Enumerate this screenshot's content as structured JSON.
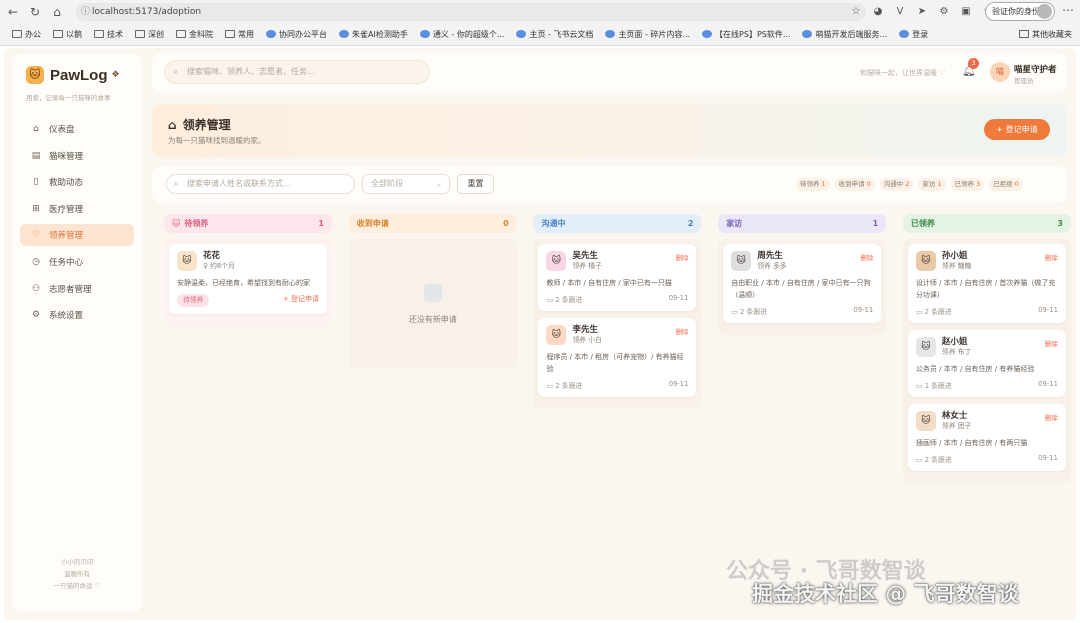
{
  "browser": {
    "url": "localhost:5173/adoption",
    "verify_label": "验证你的身份",
    "bookmarks": [
      "办公",
      "以鹅",
      "技术",
      "深创",
      "金科院",
      "常用",
      "协同办公平台",
      "朱雀AI检测助手",
      "通义 - 你的超级个...",
      "主页 - 飞书云文档",
      "主页面 - 碎片内容...",
      "【在线PS】PS软件...",
      "萌猫开发后端服务...",
      "登录"
    ],
    "other_bookmarks": "其他收藏夹"
  },
  "sidebar": {
    "app_name": "PawLog",
    "slogan": "用爱，记录每一只猫咪的故事",
    "menu": [
      {
        "label": "仪表盘",
        "icon": "home-icon",
        "glyph": "⌂"
      },
      {
        "label": "猫咪管理",
        "icon": "cat-file-icon",
        "glyph": "▤"
      },
      {
        "label": "救助动态",
        "icon": "book-icon",
        "glyph": "▯"
      },
      {
        "label": "医疗管理",
        "icon": "medical-icon",
        "glyph": "⊞"
      },
      {
        "label": "领养管理",
        "icon": "heart-icon",
        "glyph": "♡"
      },
      {
        "label": "任务中心",
        "icon": "clock-icon",
        "glyph": "◷"
      },
      {
        "label": "志愿者管理",
        "icon": "user-icon",
        "glyph": "⚇"
      },
      {
        "label": "系统设置",
        "icon": "gear-icon",
        "glyph": "⚙"
      }
    ],
    "footer": [
      "小小的爪印",
      "温暖所有",
      "一只猫的命运 ♡"
    ]
  },
  "topbar": {
    "search_placeholder": "搜索猫咪、领养人、志愿者、任务...",
    "motto": "和猫咪一起，让世界温暖 ♡",
    "notification_count": "3",
    "avatar_text": "喵",
    "user_name": "喵星守护者",
    "user_role": "管理员"
  },
  "header": {
    "title": "领养管理",
    "subtitle": "为每一只猫咪找到温暖的家。",
    "register_button": "+ 登记申请"
  },
  "filters": {
    "search_placeholder": "搜索申请人姓名或联系方式...",
    "stage_select": "全部阶段",
    "reset_button": "重置",
    "stats": [
      {
        "label": "待领养",
        "count": "1"
      },
      {
        "label": "收到申请",
        "count": "0"
      },
      {
        "label": "沟通中",
        "count": "2"
      },
      {
        "label": "家访",
        "count": "1"
      },
      {
        "label": "已领养",
        "count": "3"
      },
      {
        "label": "已拒绝",
        "count": "0"
      }
    ]
  },
  "board": {
    "columns": [
      {
        "title": "待领养",
        "icon": "🐱",
        "count": "1",
        "head_bg": "#fde7ec",
        "head_color": "#d9607a",
        "body_bg": "#fdf2f0",
        "cards": [
          {
            "name": "花花",
            "sub": "♀ 约8个月",
            "avatar": "🐱",
            "desc": "安静温柔，已经绝育，希望找到有耐心的家",
            "tag": "待领养",
            "action": "+ 登记申请"
          }
        ]
      },
      {
        "title": "收到申请",
        "icon": "",
        "count": "0",
        "head_bg": "#fdeedd",
        "head_color": "#d9822b",
        "body_bg": "#f8f1e9",
        "empty": "还没有新申请",
        "cards": []
      },
      {
        "title": "沟通中",
        "icon": "",
        "count": "2",
        "head_bg": "#e3eefb",
        "head_color": "#4b7fc2",
        "body_bg": "#f8f1e9",
        "cards": [
          {
            "name": "吴先生",
            "sub": "领养 橘子",
            "avatar": "🐱",
            "del": "删除",
            "desc": "教师 / 本市 / 自有住房 / 家中已有一只猫",
            "notes": "2 条跟进",
            "date": "09-11"
          },
          {
            "name": "李先生",
            "sub": "领养 小白",
            "avatar": "🐱",
            "del": "删除",
            "desc": "程序员 / 本市 / 租房（可养宠物）/ 有养猫经验",
            "notes": "2 条跟进",
            "date": "09-11"
          }
        ]
      },
      {
        "title": "家访",
        "icon": "",
        "count": "1",
        "head_bg": "#ebe6f8",
        "head_color": "#7a67b8",
        "body_bg": "#f8f1e9",
        "cards": [
          {
            "name": "周先生",
            "sub": "领养 多多",
            "avatar": "🐱",
            "del": "删除",
            "desc": "自由职业 / 本市 / 自有住房 / 家中已有一只狗（温顺）",
            "notes": "2 条跟进",
            "date": "09-11"
          }
        ]
      },
      {
        "title": "已领养",
        "icon": "",
        "count": "3",
        "head_bg": "#e4f3e4",
        "head_color": "#3d8b48",
        "body_bg": "#f8f1e9",
        "cards": [
          {
            "name": "孙小姐",
            "sub": "领养 糖糖",
            "avatar": "🐱",
            "del": "删除",
            "desc": "设计师 / 本市 / 自有住房 / 首次养猫（做了充分功课）",
            "notes": "2 条跟进",
            "date": "09-11"
          },
          {
            "name": "赵小姐",
            "sub": "领养 布丁",
            "avatar": "🐱",
            "del": "删除",
            "desc": "公务员 / 本市 / 自有住房 / 有养猫经验",
            "notes": "1 条跟进",
            "date": "09-11"
          },
          {
            "name": "林女士",
            "sub": "领养 团子",
            "avatar": "🐱",
            "del": "删除",
            "desc": "插画师 / 本市 / 自有住房 / 有两只猫",
            "notes": "2 条跟进",
            "date": "09-11"
          }
        ]
      }
    ]
  },
  "watermark": {
    "line1": "公众号 · 飞哥数智谈",
    "line2": "掘金技术社区 @ 飞哥数智谈"
  }
}
